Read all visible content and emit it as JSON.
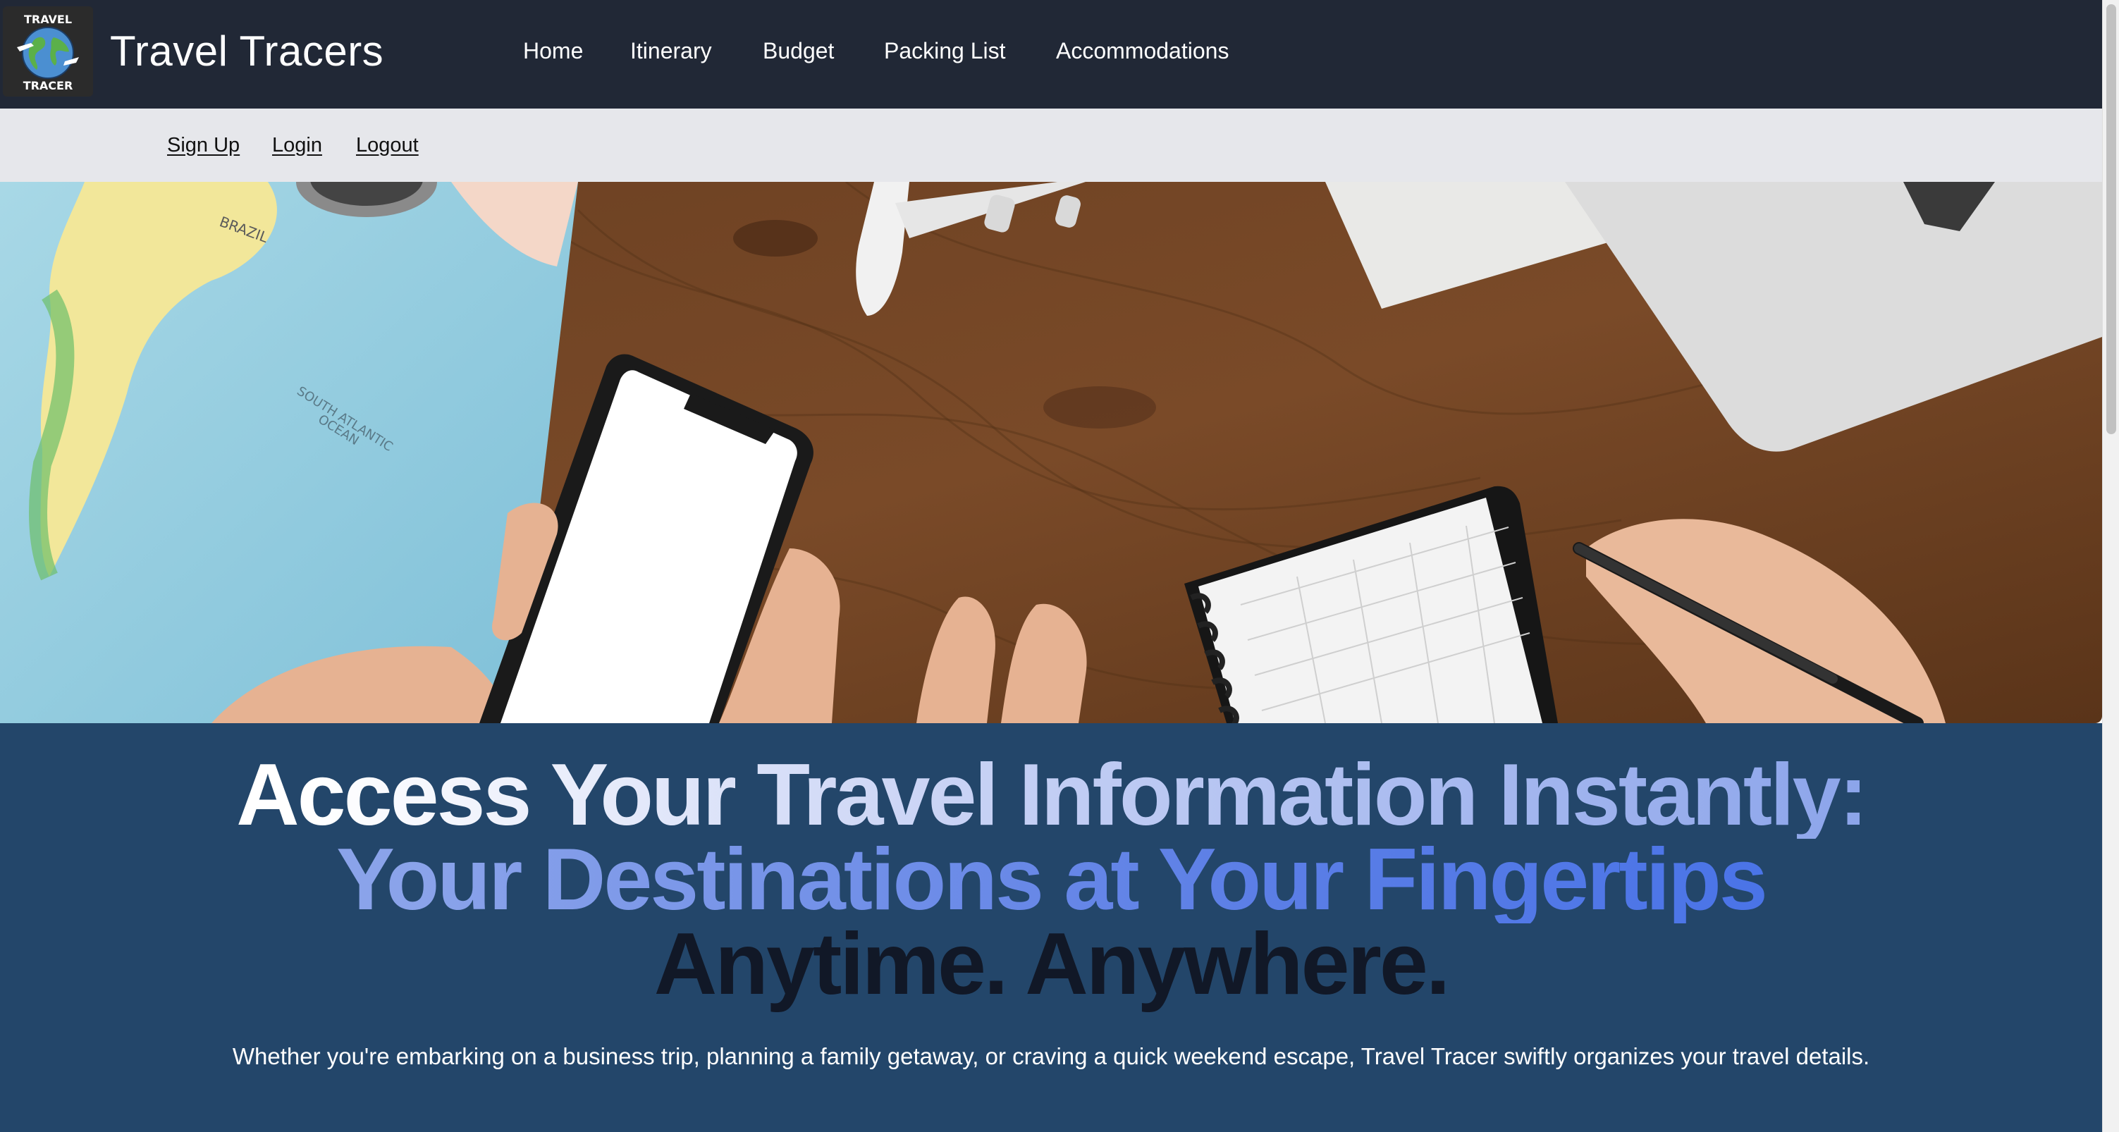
{
  "app": {
    "logo_text_top": "TRAVEL",
    "logo_text_bottom": "TRACER",
    "brand": "Travel Tracers"
  },
  "nav": {
    "items": [
      "Home",
      "Itinerary",
      "Budget",
      "Packing List",
      "Accommodations"
    ]
  },
  "auth": {
    "sign_up": "Sign Up",
    "login": "Login",
    "logout": "Logout"
  },
  "hero": {
    "map_labels": [
      "BRAZIL",
      "SOUTH ATLANTIC",
      "OCEAN"
    ]
  },
  "headline": {
    "line1": "Access Your Travel Information Instantly:",
    "line2": "Your Destinations at Your Fingertips",
    "line3": "Anytime. Anywhere."
  },
  "description": "Whether you're embarking on a business trip, planning a family getaway, or craving a quick weekend escape, Travel Tracer swiftly organizes your travel details.",
  "colors": {
    "header_bg": "#212836",
    "subbar_bg": "#e6e7eb",
    "panel_bg": "#23466a",
    "accent_blue": "#3f6de8"
  }
}
